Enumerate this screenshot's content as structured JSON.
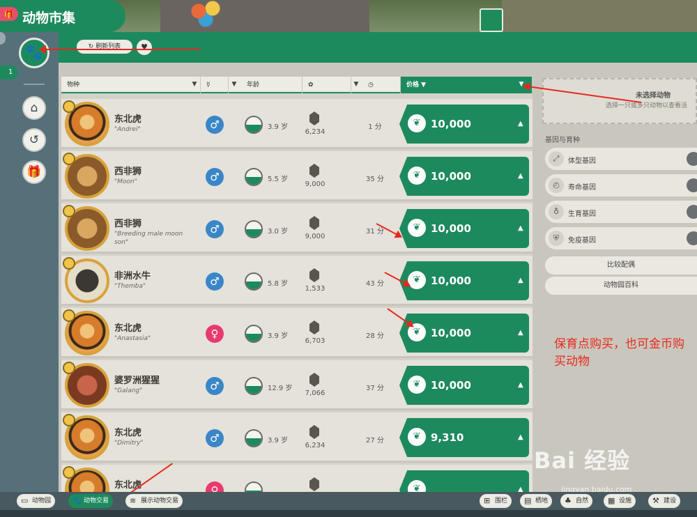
{
  "header": {
    "title": "动物市集",
    "refresh_label": "刷新列表",
    "badge_number": "1"
  },
  "columns": {
    "species": "物种",
    "age": "年龄",
    "price": "价格 ▼"
  },
  "animals": [
    {
      "species": "东北虎",
      "nickname": "\"Andrei\"",
      "sex": "♂",
      "age": "3.9 岁",
      "conservation": "6,234",
      "time": "1 分",
      "price": "10,000"
    },
    {
      "species": "西非狮",
      "nickname": "\"Moon\"",
      "sex": "♂",
      "age": "5.5 岁",
      "conservation": "9,000",
      "time": "35 分",
      "price": "10,000"
    },
    {
      "species": "西非狮",
      "nickname": "\"Breeding male moon son\"",
      "sex": "♂",
      "age": "3.0 岁",
      "conservation": "9,000",
      "time": "31 分",
      "price": "10,000"
    },
    {
      "species": "非洲水牛",
      "nickname": "\"Themba\"",
      "sex": "♂",
      "age": "5.8 岁",
      "conservation": "1,533",
      "time": "43 分",
      "price": "10,000"
    },
    {
      "species": "东北虎",
      "nickname": "\"Anastasia\"",
      "sex": "♀",
      "age": "3.9 岁",
      "conservation": "6,703",
      "time": "28 分",
      "price": "10,000"
    },
    {
      "species": "婆罗洲猩猩",
      "nickname": "\"Galang\"",
      "sex": "♂",
      "age": "12.9 岁",
      "conservation": "7,066",
      "time": "37 分",
      "price": "10,000"
    },
    {
      "species": "东北虎",
      "nickname": "\"Dimitry\"",
      "sex": "♂",
      "age": "3.9 岁",
      "conservation": "6,234",
      "time": "27 分",
      "price": "9,310"
    },
    {
      "species": "东北虎",
      "nickname": "",
      "sex": "♀",
      "age": "",
      "conservation": "",
      "time": "",
      "price": ""
    }
  ],
  "right_panel": {
    "no_selection_title": "未选择动物",
    "no_selection_hint": "选择一只或多只动物以查看活",
    "genetics_title": "基因与育种",
    "genes": [
      "体型基因",
      "寿命基因",
      "生育基因",
      "免疫基因"
    ],
    "compare_label": "比较配偶",
    "encyclopedia_label": "动物园百科"
  },
  "annotation": "保育点购买，也可金币购买动物",
  "watermark": {
    "main": "Bai 经验",
    "sub": "jingyan.baidu.com"
  },
  "bottom_bar": {
    "left": [
      {
        "label": "动物园",
        "icon": "zoo-icon"
      },
      {
        "label": "动物交易",
        "icon": "paw-icon"
      },
      {
        "label": "展示动物交易",
        "icon": "exhibit-icon"
      }
    ],
    "right": [
      {
        "label": "围栏",
        "icon": "fence-icon"
      },
      {
        "label": "栖地",
        "icon": "habitat-icon"
      },
      {
        "label": "自然",
        "icon": "nature-icon"
      },
      {
        "label": "设施",
        "icon": "facility-icon"
      },
      {
        "label": "建设",
        "icon": "build-icon"
      }
    ]
  },
  "colors": {
    "primary": "#1d8a5e",
    "male": "#3a86c8",
    "female": "#e83a6e",
    "annotation": "#e8281e"
  }
}
